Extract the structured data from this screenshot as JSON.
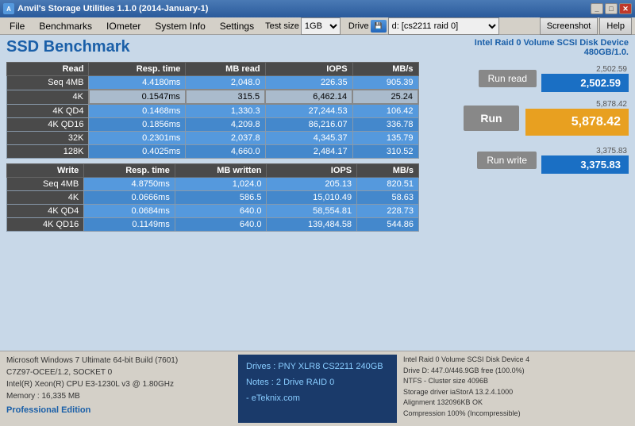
{
  "titlebar": {
    "title": "Anvil's Storage Utilities 1.1.0 (2014-January-1)"
  },
  "menu": {
    "items": [
      "File",
      "Benchmarks",
      "IOmeter",
      "System Info",
      "Settings",
      "Test size",
      "Drive",
      "Screenshot",
      "Help"
    ]
  },
  "toolbar": {
    "testsize_label": "Test size",
    "testsize_value": "1GB",
    "drive_label": "Drive",
    "drive_value": "d: [cs2211 raid 0]",
    "screenshot_label": "Screenshot",
    "help_label": "Help"
  },
  "benchmark": {
    "title": "SSD Benchmark",
    "device_line1": "Intel Raid 0 Volume SCSI Disk Device",
    "device_line2": "480GB/1.0.",
    "read_headers": [
      "Read",
      "Resp. time",
      "MB read",
      "IOPS",
      "MB/s"
    ],
    "read_rows": [
      [
        "Seq 4MB",
        "4.4180ms",
        "2,048.0",
        "226.35",
        "905.39"
      ],
      [
        "4K",
        "0.1547ms",
        "315.5",
        "6,462.14",
        "25.24"
      ],
      [
        "4K QD4",
        "0.1468ms",
        "1,330.3",
        "27,244.53",
        "106.42"
      ],
      [
        "4K QD16",
        "0.1856ms",
        "4,209.8",
        "86,216.07",
        "336.78"
      ],
      [
        "32K",
        "0.2301ms",
        "2,037.8",
        "4,345.37",
        "135.79"
      ],
      [
        "128K",
        "0.4025ms",
        "4,660.0",
        "2,484.17",
        "310.52"
      ]
    ],
    "write_headers": [
      "Write",
      "Resp. time",
      "MB written",
      "IOPS",
      "MB/s"
    ],
    "write_rows": [
      [
        "Seq 4MB",
        "4.8750ms",
        "1,024.0",
        "205.13",
        "820.51"
      ],
      [
        "4K",
        "0.0666ms",
        "586.5",
        "15,010.49",
        "58.63"
      ],
      [
        "4K QD4",
        "0.0684ms",
        "640.0",
        "58,554.81",
        "228.73"
      ],
      [
        "4K QD16",
        "0.1149ms",
        "640.0",
        "139,484.58",
        "544.86"
      ]
    ]
  },
  "scores": {
    "read_label": "2,502.59",
    "read_value": "2,502.59",
    "run_label": "Run read",
    "total_label": "5,878.42",
    "total_value": "5,878.42",
    "run_main_label": "Run",
    "write_label": "3,375.83",
    "write_value": "3,375.83",
    "run_write_label": "Run write"
  },
  "statusbar": {
    "os": "Microsoft Windows 7 Ultimate  64-bit Build (7601)",
    "cpu1": "C7Z97-OCEE/1.2, SOCKET 0",
    "cpu2": "Intel(R) Xeon(R) CPU E3-1230L v3 @ 1.80GHz",
    "memory": "Memory : 16,335 MB",
    "edition": "Professional Edition",
    "drives_line1": "Drives : PNY XLR8 CS2211 240GB",
    "drives_line2": "Notes : 2 Drive RAID 0",
    "drives_line3": "          - eTeknix.com",
    "info_line1": "Intel Raid 0 Volume SCSI Disk Device 4",
    "info_line2": "Drive D: 447.0/446.9GB free (100.0%)",
    "info_line3": "NTFS - Cluster size 4096B",
    "info_line4": "Storage driver  iaStorA 13.2.4.1000",
    "info_line5": "",
    "info_line6": "Alignment 132096KB OK",
    "info_line7": "Compression 100% (Incompressible)"
  }
}
